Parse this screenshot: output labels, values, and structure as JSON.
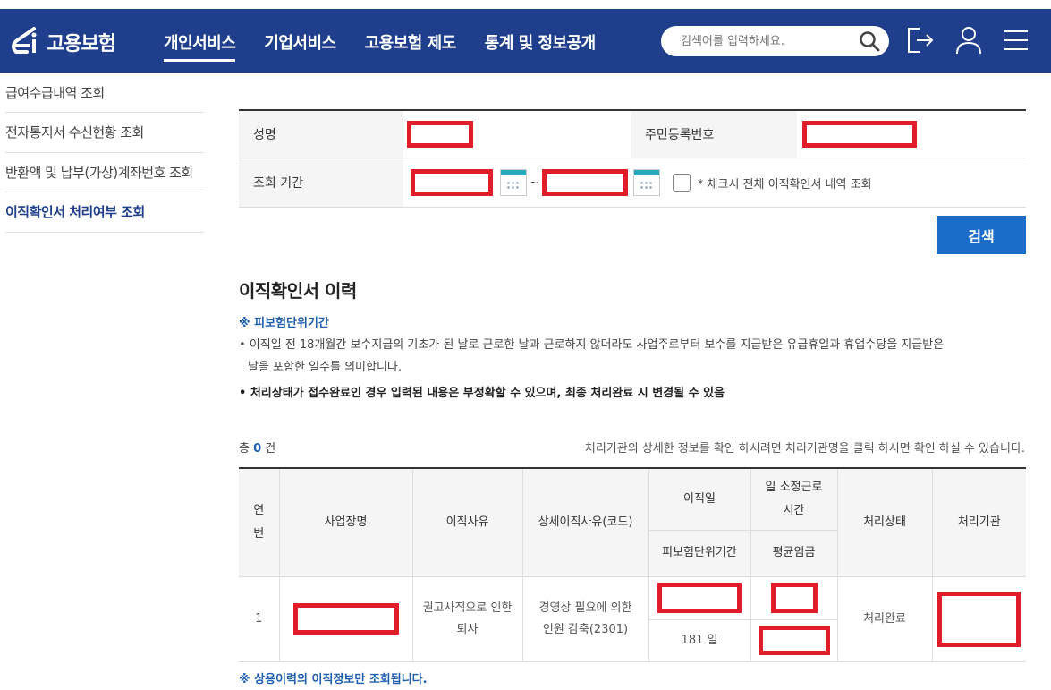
{
  "header": {
    "logo_text": "고용보험",
    "nav": [
      "개인서비스",
      "기업서비스",
      "고용보험 제도",
      "통계 및 정보공개"
    ],
    "search_placeholder": "검색어를 입력하세요."
  },
  "sidebar": {
    "items": [
      {
        "label": "급여수급내역 조회"
      },
      {
        "label": "전자통지서 수신현황 조회"
      },
      {
        "label": "반환액 및 납부(가상)계좌번호 조회"
      },
      {
        "label": "이직확인서 처리여부 조회"
      }
    ]
  },
  "form": {
    "name_label": "성명",
    "rrn_label": "주민등록번호",
    "period_label": "조회 기간",
    "tilde": "~",
    "checkbox_label": "* 체크시 전체 이직확인서 내역 조회",
    "search_button": "검색"
  },
  "section": {
    "title": "이직확인서 이력",
    "note_head": "※ 피보험단위기간",
    "bullet1": "• 이직일 전 18개월간 보수지급의 기초가 된 날로 근로한 날과 근로하지 않더라도 사업주로부터 보수를 지급받은 유급휴일과 휴업수당을 지급받은",
    "bullet1b": "날을 포함한 일수를 의미합니다.",
    "bullet2": "• 처리상태가 접수완료인 경우 입력된 내용은 부정확할 수 있으며, 최종 처리완료 시 변경될 수 있음"
  },
  "results": {
    "count_prefix": "총",
    "count": "0",
    "count_suffix": "건",
    "hint": "처리기관의 상세한 정보를 확인 하시려면 처리기관명을 클릭 하시면 확인 하실 수 있습니다.",
    "columns": {
      "no": "연번",
      "company": "사업장명",
      "reason": "이직사유",
      "detail_reason": "상세이직사유(코드)",
      "leave_date": "이직일",
      "insured_period": "피보험단위기간",
      "work_hours_1": "일 소정근로",
      "work_hours_2": "시간",
      "avg_wage": "평균임금",
      "status": "처리상태",
      "agency": "처리기관"
    },
    "rows": [
      {
        "no": "1",
        "reason": "권고사직으로 인한 퇴사",
        "detail_reason": "경영상 필요에 의한 인원 감축(2301)",
        "insured_period": "181 일",
        "status": "처리완료"
      }
    ]
  },
  "footer_note": "※ 상용이력의 이직정보만 조회됩니다.",
  "colors": {
    "header_bg": "#1f3f8c",
    "accent_blue": "#1b6dc9",
    "redaction": "#e21d2a"
  }
}
